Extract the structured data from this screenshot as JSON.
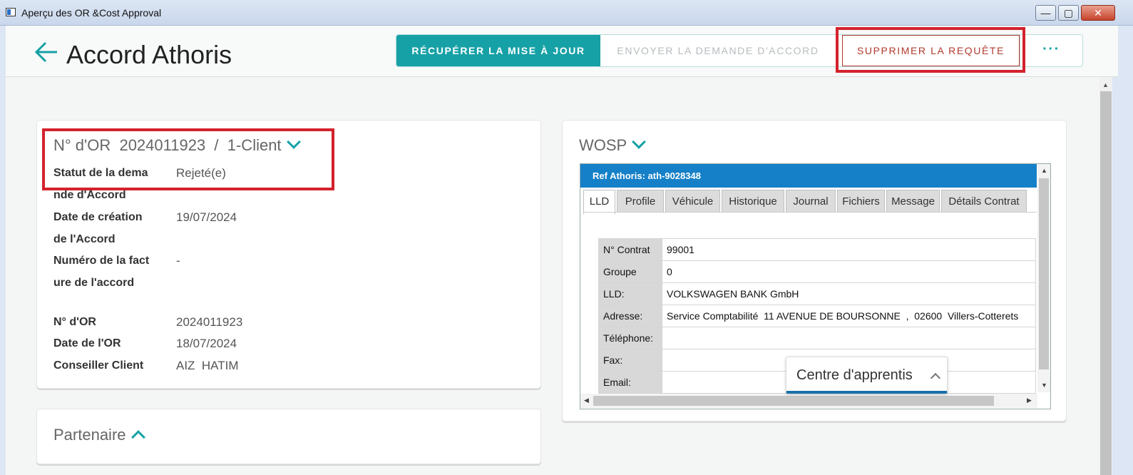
{
  "window": {
    "title": "Aperçu des OR &Cost Approval"
  },
  "header": {
    "title": "Accord Athoris",
    "buttons": {
      "fetch_update": "RÉCUPÉRER LA MISE À JOUR",
      "send_request": "ENVOYER LA DEMANDE D'ACCORD",
      "delete_request": "SUPPRIMER LA REQUÊTE",
      "more": "···"
    }
  },
  "or_card": {
    "heading": "N° d'OR  2024011923  /  1-Client",
    "fields": [
      {
        "label1": "Statut de la dema",
        "label2": "nde d'Accord",
        "value": "Rejeté(e)"
      },
      {
        "label1": "Date de création",
        "label2": "de l'Accord",
        "value": "19/07/2024"
      },
      {
        "label1": "Numéro de la fact",
        "label2": "ure de l'accord",
        "value": "-"
      },
      {
        "label1": "N° d'OR",
        "value": "2024011923"
      },
      {
        "label1": "Date de l'OR",
        "value": "18/07/2024"
      },
      {
        "label1": "Conseiller Client",
        "value": "AIZ  HATIM"
      }
    ]
  },
  "partner_card": {
    "heading": "Partenaire"
  },
  "wosp_card": {
    "heading": "WOSP",
    "ref": "Ref Athoris: ath-9028348",
    "tabs": [
      "LLD",
      "Profile",
      "Véhicule",
      "Historique",
      "Journal",
      "Fichiers",
      "Message",
      "Détails Contrat"
    ],
    "rows": [
      {
        "label": "N° Contrat",
        "value": "99001"
      },
      {
        "label": "Groupe",
        "value": "0"
      },
      {
        "label": "LLD:",
        "value": "VOLKSWAGEN BANK GmbH"
      },
      {
        "label": "Adresse:",
        "value": "Service Comptabilité  11 AVENUE DE BOURSONNE  ,  02600  Villers-Cotterets"
      },
      {
        "label": "Téléphone:",
        "value": ""
      },
      {
        "label": "Fax:",
        "value": ""
      },
      {
        "label": "Email:",
        "value": ""
      }
    ]
  },
  "learning_center": {
    "label": "Centre d'apprentis"
  },
  "colors": {
    "accent": "#16a1a6",
    "danger": "#b23a2d",
    "highlight": "#d3222d",
    "wosp_blue": "#1580c8"
  }
}
